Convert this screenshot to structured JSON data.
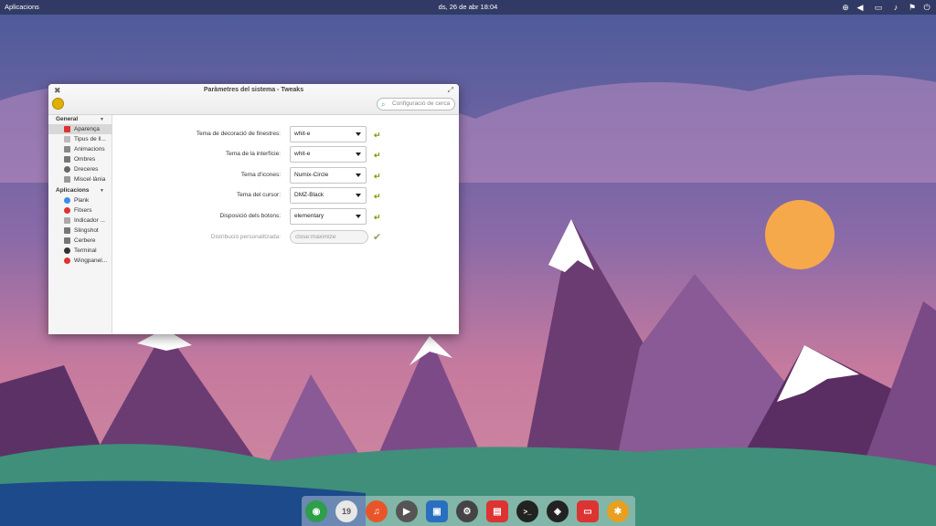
{
  "panel": {
    "apps_label": "Aplicacions",
    "clock": "ds, 26 de abr 18:04",
    "indicators": [
      "network-icon",
      "volume-icon",
      "display-icon",
      "notification-icon",
      "power-icon"
    ]
  },
  "window": {
    "title": "Paràmetres del sistema - Tweaks",
    "search_placeholder": "Configuració de cerca"
  },
  "sidebar": {
    "general_header": "General",
    "general_items": [
      {
        "label": "Aparença",
        "color": "#d33"
      },
      {
        "label": "Tipus de ll...",
        "color": "#999"
      },
      {
        "label": "Animacions",
        "color": "#888"
      },
      {
        "label": "Ombres",
        "color": "#777"
      },
      {
        "label": "Dreceres",
        "color": "#666"
      },
      {
        "label": "Miscel·lània",
        "color": "#888"
      }
    ],
    "apps_header": "Aplicacions",
    "apps_items": [
      {
        "label": "Plank",
        "color": "#3a8ee6"
      },
      {
        "label": "Fitxers",
        "color": "#d33"
      },
      {
        "label": "Indicador ...",
        "color": "#999"
      },
      {
        "label": "Slingshot",
        "color": "#777"
      },
      {
        "label": "Cerbere",
        "color": "#777"
      },
      {
        "label": "Terminal",
        "color": "#333"
      },
      {
        "label": "Wingpanel...",
        "color": "#d33"
      }
    ]
  },
  "settings": [
    {
      "label": "Tema de decoració de finestres:",
      "value": "whit-e"
    },
    {
      "label": "Tema de la interfície:",
      "value": "whit-e"
    },
    {
      "label": "Tema d'icones:",
      "value": "Numix-Circle"
    },
    {
      "label": "Tema del cursor:",
      "value": "DMZ-Black"
    },
    {
      "label": "Disposició dels botons:",
      "value": "elementary"
    }
  ],
  "custom_layout": {
    "label": "Distribució personalitzada:",
    "value": "close:maximize"
  },
  "dock": {
    "items": [
      {
        "name": "browser-icon",
        "color": "#2e9e4a"
      },
      {
        "name": "calendar-icon",
        "color": "#e0e0e0",
        "text": "19"
      },
      {
        "name": "music-icon",
        "color": "#e8552a"
      },
      {
        "name": "video-icon",
        "color": "#555"
      },
      {
        "name": "photos-icon",
        "color": "#2a6fbf"
      },
      {
        "name": "switchboard-icon",
        "color": "#444"
      },
      {
        "name": "appcenter-icon",
        "color": "#d33"
      },
      {
        "name": "terminal-icon",
        "color": "#222",
        "text": ">_"
      },
      {
        "name": "steam-icon",
        "color": "#222"
      },
      {
        "name": "files-icon",
        "color": "#d33"
      },
      {
        "name": "pinwheel-icon",
        "color": "#e8a020"
      }
    ]
  }
}
